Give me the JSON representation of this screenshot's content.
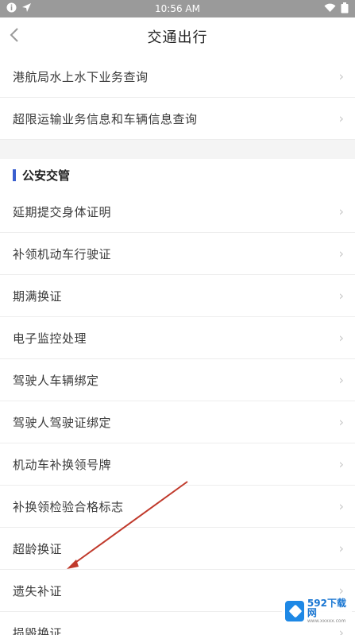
{
  "status_bar": {
    "time": "10:56 AM",
    "left_icons": [
      "info-icon",
      "location-icon"
    ],
    "right_icons": [
      "wifi-icon",
      "battery-icon"
    ]
  },
  "navbar": {
    "title": "交通出行",
    "back_icon": "chevron-left-icon"
  },
  "top_items": [
    {
      "label": "港航局水上水下业务查询"
    },
    {
      "label": "超限运输业务信息和车辆信息查询"
    }
  ],
  "section": {
    "title": "公安交管",
    "accent_color": "#3a5fcf",
    "items": [
      {
        "label": "延期提交身体证明"
      },
      {
        "label": "补领机动车行驶证"
      },
      {
        "label": "期满换证"
      },
      {
        "label": "电子监控处理"
      },
      {
        "label": "驾驶人车辆绑定"
      },
      {
        "label": "驾驶人驾驶证绑定"
      },
      {
        "label": "机动车补换领号牌"
      },
      {
        "label": "补换领检验合格标志"
      },
      {
        "label": "超龄换证"
      },
      {
        "label": "遗失补证"
      },
      {
        "label": "损毁换证"
      }
    ]
  },
  "annotation": {
    "color": "#c0392b",
    "points_to": "遗失补证"
  },
  "watermark": {
    "main": "592下载网",
    "sub": "www.xxxxx.com"
  }
}
